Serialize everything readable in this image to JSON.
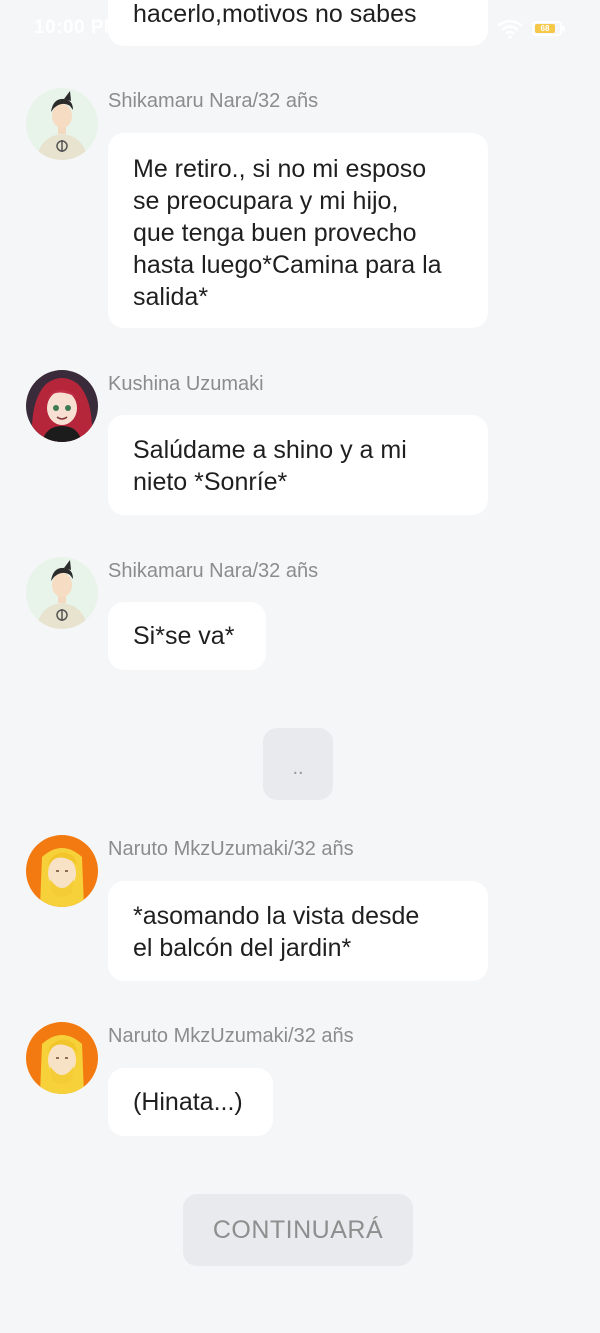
{
  "status_bar": {
    "time": "10:00 PM",
    "battery": "68"
  },
  "messages": [
    {
      "sender": "",
      "text": "hacerlo,motivos no sabes",
      "avatar": ""
    },
    {
      "sender": "Shikamaru Nara/32 añs",
      "text": "Me retiro., si no mi esposo\nse preocupara y mi hijo,\nque tenga buen provecho\nhasta luego*Camina para la\nsalida*",
      "avatar": "shikamaru-avatar"
    },
    {
      "sender": "Kushina Uzumaki",
      "text": "Salúdame a shino y a mi\nnieto *Sonríe*",
      "avatar": "kushina-avatar"
    },
    {
      "sender": "Shikamaru Nara/32 añs",
      "text": "Si*se va*",
      "avatar": "shikamaru-avatar"
    },
    {
      "sender": "Naruto  MkzUzumaki/32 añs",
      "text": "*asomando la vista desde\nel balcón del jardin*",
      "avatar": "naruto-avatar"
    },
    {
      "sender": "Naruto  MkzUzumaki/32 añs",
      "text": "(Hinata...)",
      "avatar": "naruto-avatar"
    }
  ],
  "typing_indicator": "..",
  "continue_label": "CONTINUARÁ",
  "colors": {
    "background": "#f5f6f8",
    "bubble": "#ffffff",
    "sender_text": "#8c8c8c",
    "message_text": "#1f1f1f",
    "button_bg": "#e9eaed"
  }
}
